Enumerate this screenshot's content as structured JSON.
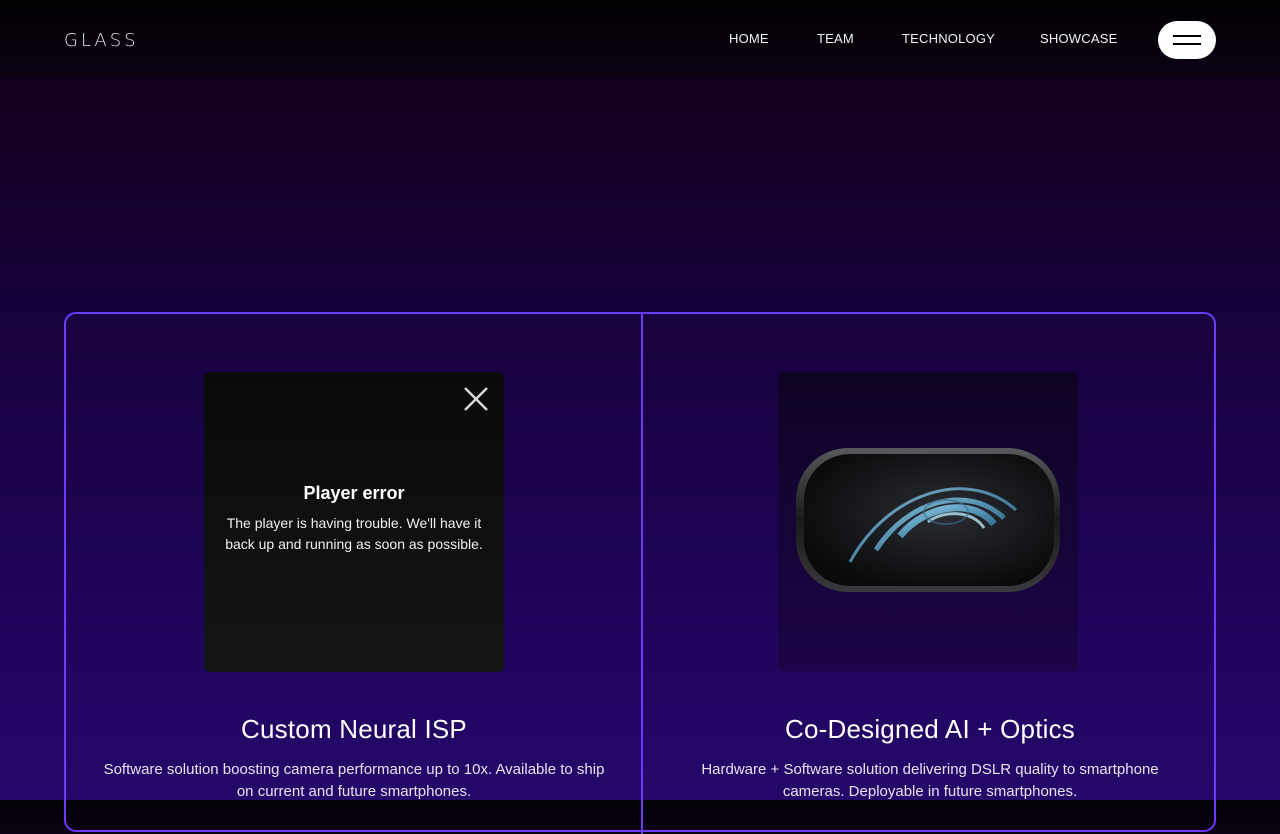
{
  "header": {
    "logo": "GLASS",
    "nav": [
      "HOME",
      "TEAM",
      "TECHNOLOGY",
      "SHOWCASE"
    ],
    "menu_icon": "hamburger-icon"
  },
  "cards": [
    {
      "media_type": "video-player",
      "player": {
        "title": "Player error",
        "message": "The player is having trouble. We'll have it back up and running as soon as possible.",
        "close_icon": "close-icon"
      },
      "title": "Custom Neural ISP",
      "description": "Software solution boosting camera performance up to 10x. Available to ship on current and future smartphones."
    },
    {
      "media_type": "image",
      "media_icon": "camera-lens-image",
      "title": "Co-Designed AI + Optics",
      "description": "Hardware + Software solution delivering DSLR quality to smartphone cameras. Deployable in future smartphones."
    }
  ],
  "colors": {
    "accent_border": "#6b3cff",
    "background_top": "#13011f",
    "background_bottom": "#24086a",
    "menu_button": "#ffffff"
  }
}
